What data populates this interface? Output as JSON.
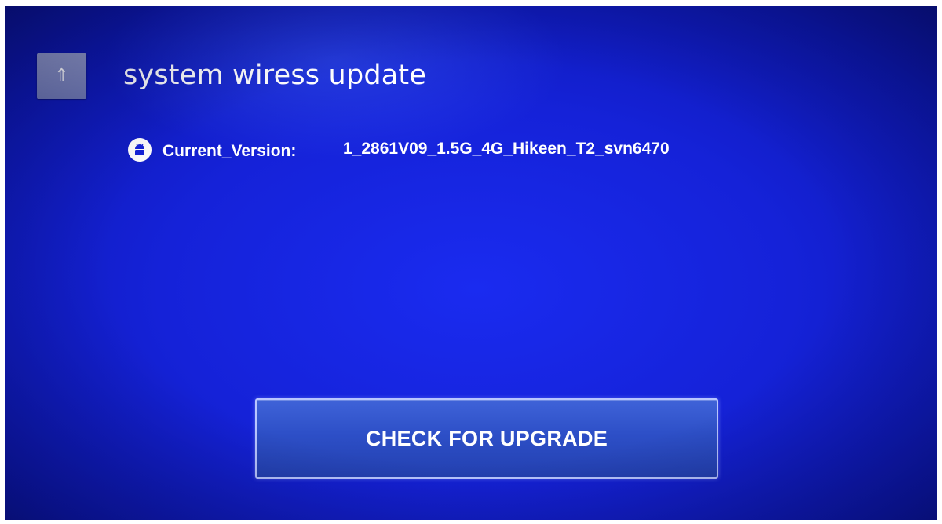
{
  "header": {
    "title": "system wiress update",
    "back_icon": "up-arrow-icon"
  },
  "info": {
    "icon": "android-icon",
    "label": "Current_Version:",
    "value": "1_2861V09_1.5G_4G_Hikeen_T2_svn6470"
  },
  "actions": {
    "upgrade_label": "CHECK FOR UPGRADE"
  },
  "colors": {
    "background": "#1522d8",
    "button": "#2d4fc7",
    "button_border": "#b9c6ff",
    "back_button": "#7f88bf"
  }
}
